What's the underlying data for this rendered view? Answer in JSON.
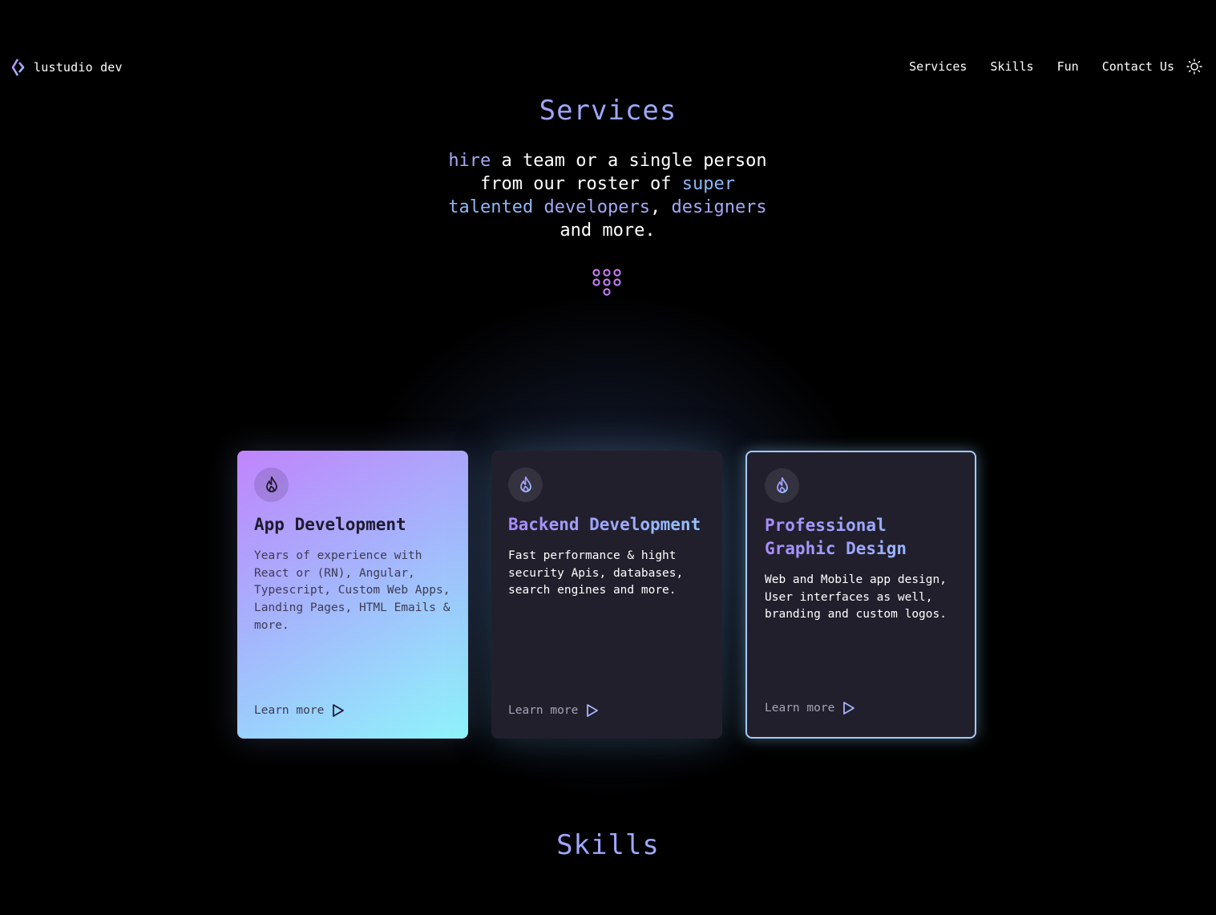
{
  "nav": {
    "brand": "lustudio dev",
    "brand_icon": "diamond-arrows-logo-icon",
    "links": [
      "Services",
      "Skills",
      "Fun",
      "Contact Us"
    ],
    "theme_icon": "sun-icon"
  },
  "hero": {
    "title": "Services",
    "tagline": {
      "w1": "hire",
      "t1": " a team or a single person from our roster of ",
      "w2": "super talented",
      "t2": " ",
      "w3": "developers",
      "t3": ", ",
      "w4": "designers",
      "t4": " and more."
    },
    "dots_icon": "dots-grid-icon"
  },
  "cards": [
    {
      "icon": "flame-icon",
      "title": "App Development",
      "description": "Years of experience with React or (RN), Angular, Typescript, Custom Web Apps, Landing Pages, HTML Emails & more.",
      "link": "Learn more"
    },
    {
      "icon": "flame-icon",
      "title": "Backend Development",
      "description": "Fast performance & hight security Apis, databases, search engines and more.",
      "link": "Learn more"
    },
    {
      "icon": "flame-icon",
      "title": "Professional Graphic Design",
      "description": "Web and Mobile app design, User interfaces as well, branding and custom logos.",
      "link": "Learn more"
    }
  ],
  "skills": {
    "title": "Skills"
  },
  "colors": {
    "background": "#000000",
    "accent_purple": "#a78bfa",
    "accent_blue": "#93c5fd",
    "card_dark": "#221f2d",
    "card_gradient_start": "#c084fc",
    "card_gradient_end": "#8ff4fb"
  }
}
